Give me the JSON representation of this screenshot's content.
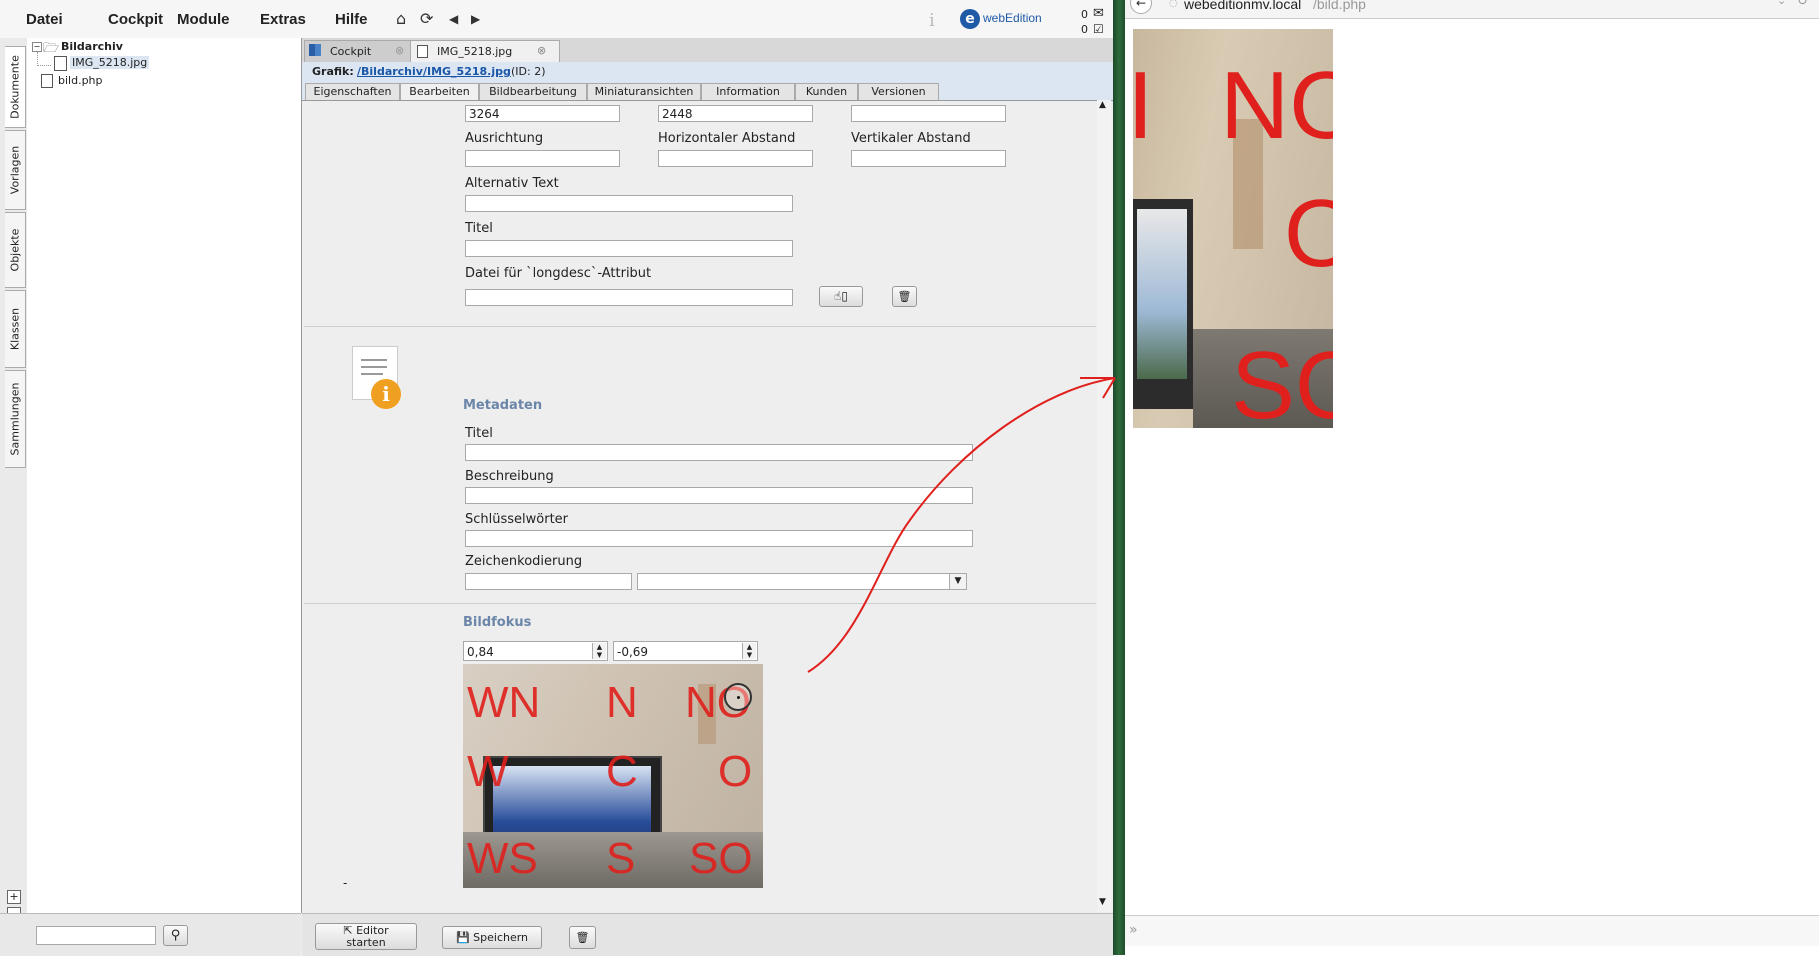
{
  "menu": {
    "items": [
      "Datei",
      "Cockpit",
      "Module",
      "Extras",
      "Hilfe"
    ],
    "brand": "webEdition",
    "counter_top": "0",
    "counter_bottom": "0"
  },
  "vertical_tabs": [
    "Dokumente",
    "Vorlagen",
    "Objekte",
    "Klassen",
    "Sammlungen"
  ],
  "tree": {
    "folder": "Bildarchiv",
    "image_file": "IMG_5218.jpg",
    "php_file": "bild.php"
  },
  "doc_tabs": [
    "Cockpit",
    "IMG_5218.jpg"
  ],
  "grafik": {
    "label": "Grafik:",
    "path": "/Bildarchiv/IMG_5218.jpg",
    "id": "(ID: 2)"
  },
  "sub_tabs": [
    "Eigenschaften",
    "Bearbeiten",
    "Bildbearbeitung",
    "Miniaturansichten",
    "Information",
    "Kunden",
    "Versionen"
  ],
  "properties": {
    "width_value": "3264",
    "height_value": "2448",
    "ausrichtung_label": "Ausrichtung",
    "horizontal_label": "Horizontaler Abstand",
    "vertical_label": "Vertikaler Abstand",
    "alt_label": "Alternativ Text",
    "title_label": "Titel",
    "longdesc_label": "Datei für `longdesc`-Attribut"
  },
  "metadata": {
    "section_title": "Metadaten",
    "title_label": "Titel",
    "description_label": "Beschreibung",
    "keywords_label": "Schlüsselwörter",
    "encoding_label": "Zeichenkodierung"
  },
  "focus": {
    "section_title": "Bildfokus",
    "x_value": "0,84",
    "y_value": "-0,69",
    "dash": "-",
    "grid_labels": [
      "WN",
      "N",
      "NO",
      "W",
      "C",
      "O",
      "WS",
      "S",
      "SO"
    ]
  },
  "bottom_buttons": {
    "editor_line1": "Editor",
    "editor_line2": "starten",
    "save": "Speichern"
  },
  "browser": {
    "url_host": "webeditionmv.local",
    "url_path": "/bild.php",
    "preview_labels": [
      "I",
      "NO",
      "O",
      "SO"
    ]
  },
  "colors": {
    "accent_link": "#1a57a8",
    "section_title": "#6b86a8",
    "annotation": "#e0201c",
    "brand_blue": "#1f5aa6"
  }
}
